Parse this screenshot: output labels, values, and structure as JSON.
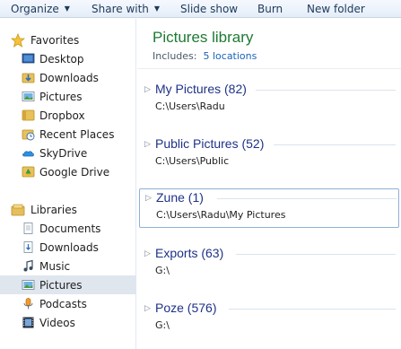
{
  "toolbar": {
    "organize": "Organize",
    "share_with": "Share with",
    "slide_show": "Slide show",
    "burn": "Burn",
    "new_folder": "New folder"
  },
  "nav": {
    "favorites": {
      "label": "Favorites",
      "items": [
        {
          "label": "Desktop",
          "icon": "desktop-icon"
        },
        {
          "label": "Downloads",
          "icon": "downloads-folder-icon"
        },
        {
          "label": "Pictures",
          "icon": "pictures-icon"
        },
        {
          "label": "Dropbox",
          "icon": "dropbox-folder-icon"
        },
        {
          "label": "Recent Places",
          "icon": "recent-places-icon"
        },
        {
          "label": "SkyDrive",
          "icon": "skydrive-icon"
        },
        {
          "label": "Google Drive",
          "icon": "google-drive-icon"
        }
      ]
    },
    "libraries": {
      "label": "Libraries",
      "items": [
        {
          "label": "Documents",
          "icon": "documents-icon"
        },
        {
          "label": "Downloads",
          "icon": "downloads-icon"
        },
        {
          "label": "Music",
          "icon": "music-icon"
        },
        {
          "label": "Pictures",
          "icon": "pictures-icon",
          "selected": true
        },
        {
          "label": "Podcasts",
          "icon": "podcasts-icon"
        },
        {
          "label": "Videos",
          "icon": "videos-icon"
        }
      ]
    }
  },
  "content": {
    "title": "Pictures library",
    "includes_label": "Includes:",
    "includes_value": "5 locations",
    "groups": [
      {
        "title": "My Pictures (82)",
        "path": "C:\\Users\\Radu"
      },
      {
        "title": "Public Pictures (52)",
        "path": "C:\\Users\\Public"
      },
      {
        "title": "Zune (1)",
        "path": "C:\\Users\\Radu\\My Pictures",
        "focused": true
      },
      {
        "title": "Exports (63)",
        "path": "G:\\"
      },
      {
        "title": "Poze (576)",
        "path": "G:\\"
      }
    ]
  },
  "colors": {
    "title_green": "#1e7a32",
    "group_blue": "#1e3287",
    "link_blue": "#1a64b8",
    "selected_bg": "#dfe6ee"
  }
}
